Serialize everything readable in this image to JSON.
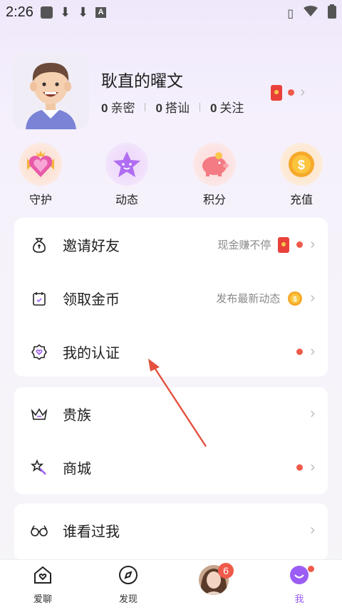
{
  "status_bar": {
    "time": "2:26"
  },
  "profile": {
    "name": "耿直的曜文",
    "stats": [
      {
        "num": "0",
        "label": "亲密"
      },
      {
        "num": "0",
        "label": "搭讪"
      },
      {
        "num": "0",
        "label": "关注"
      }
    ]
  },
  "quick_actions": [
    {
      "label": "守护",
      "icon": "guard-heart-icon"
    },
    {
      "label": "动态",
      "icon": "star-icon"
    },
    {
      "label": "积分",
      "icon": "piggy-bank-icon"
    },
    {
      "label": "充值",
      "icon": "coin-icon"
    }
  ],
  "menu_group1": [
    {
      "label": "邀请好友",
      "hint": "现金赚不停",
      "icon": "money-bag-icon"
    },
    {
      "label": "领取金币",
      "hint": "发布最新动态",
      "icon": "calendar-icon"
    },
    {
      "label": "我的认证",
      "hint": "",
      "icon": "badge-icon"
    }
  ],
  "menu_group2": [
    {
      "label": "贵族",
      "icon": "crown-icon"
    },
    {
      "label": "商城",
      "icon": "magic-wand-icon"
    }
  ],
  "menu_group3": [
    {
      "label": "谁看过我",
      "icon": "glasses-icon"
    }
  ],
  "coin_symbol": "$",
  "tabbar": {
    "tabs": [
      {
        "label": "爱聊",
        "icon": "heart-home-icon"
      },
      {
        "label": "发现",
        "icon": "compass-icon"
      },
      {
        "label": "",
        "icon": "avatar-photo"
      },
      {
        "label": "我",
        "icon": "smile-icon"
      }
    ],
    "badge": "6"
  },
  "colors": {
    "accent": "#9b5cf6",
    "red": "#ef5a4b",
    "arrow": "#e4503e"
  }
}
